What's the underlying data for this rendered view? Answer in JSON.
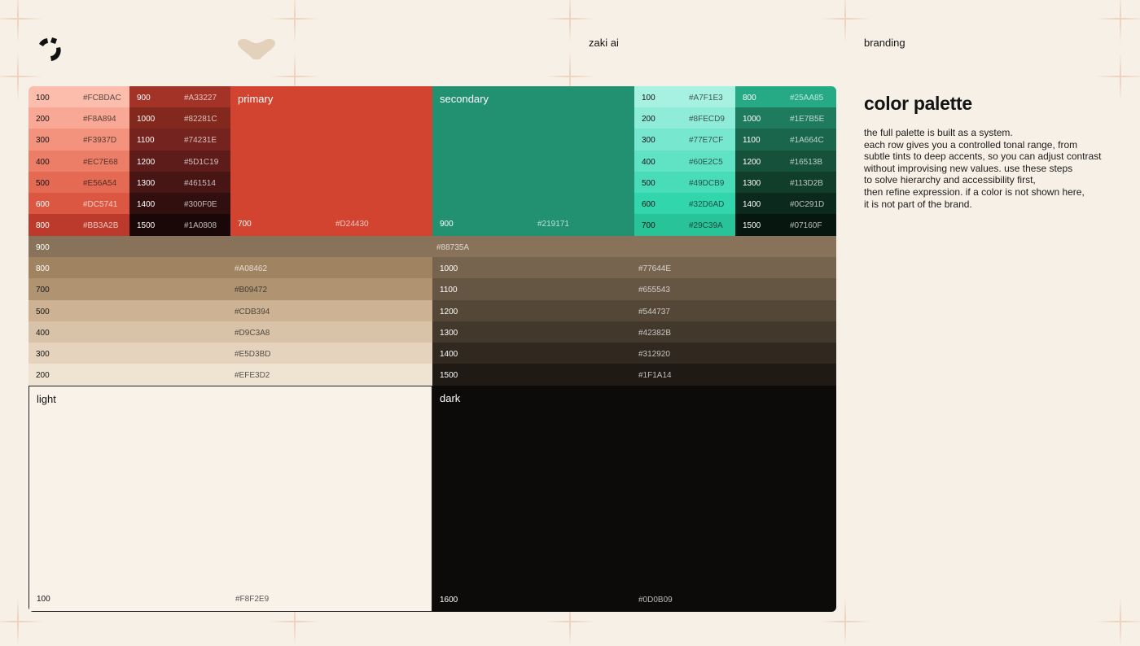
{
  "header": {
    "app_name": "zaki ai",
    "section": "branding"
  },
  "panel": {
    "title": "color palette",
    "description": "the full palette is built as a system.\neach row gives you a controlled tonal range, from\nsubtle tints to deep accents, so you can adjust contrast\nwithout improvising new values. use these steps\nto solve hierarchy and accessibility first,\nthen refine expression. if a color is not shown here,\nit is not part of the brand."
  },
  "colors": {
    "page_bg": "#F6F0E6",
    "accent": "#D24430"
  },
  "icons": [
    "logo-icon",
    "heart-mark-icon"
  ],
  "palette": {
    "primary_tints": [
      {
        "level": "100",
        "hex": "#FCBDAC"
      },
      {
        "level": "200",
        "hex": "#F8A894"
      },
      {
        "level": "300",
        "hex": "#F3937D"
      },
      {
        "level": "400",
        "hex": "#EC7E68"
      },
      {
        "level": "500",
        "hex": "#E56A54"
      },
      {
        "level": "600",
        "hex": "#DC5741"
      },
      {
        "level": "800",
        "hex": "#BB3A2B"
      }
    ],
    "primary_shades": [
      {
        "level": "900",
        "hex": "#A33227"
      },
      {
        "level": "1000",
        "hex": "#82281C"
      },
      {
        "level": "1100",
        "hex": "#74231E"
      },
      {
        "level": "1200",
        "hex": "#5D1C19"
      },
      {
        "level": "1300",
        "hex": "#461514"
      },
      {
        "level": "1400",
        "hex": "#300F0E"
      },
      {
        "level": "1500",
        "hex": "#1A0808"
      }
    ],
    "primary_main": {
      "name": "primary",
      "level": "700",
      "hex": "#D24430"
    },
    "secondary_main": {
      "name": "secondary",
      "level": "900",
      "hex": "#219171"
    },
    "secondary_tints": [
      {
        "level": "100",
        "hex": "#A7F1E3"
      },
      {
        "level": "200",
        "hex": "#8FECD9"
      },
      {
        "level": "300",
        "hex": "#77E7CF"
      },
      {
        "level": "400",
        "hex": "#60E2C5"
      },
      {
        "level": "500",
        "hex": "#49DCB9"
      },
      {
        "level": "600",
        "hex": "#32D6AD"
      },
      {
        "level": "700",
        "hex": "#29C39A"
      }
    ],
    "secondary_shades": [
      {
        "level": "800",
        "hex": "#25AA85"
      },
      {
        "level": "1000",
        "hex": "#1E7B5E"
      },
      {
        "level": "1100",
        "hex": "#1A664C"
      },
      {
        "level": "1200",
        "hex": "#16513B"
      },
      {
        "level": "1300",
        "hex": "#113D2B"
      },
      {
        "level": "1400",
        "hex": "#0C291D"
      },
      {
        "level": "1500",
        "hex": "#07160F"
      }
    ],
    "neutral_900": {
      "level": "900",
      "hex": "#88735A"
    },
    "neutral_light": [
      {
        "level": "800",
        "hex": "#A08462"
      },
      {
        "level": "700",
        "hex": "#B09472"
      },
      {
        "level": "500",
        "hex": "#CDB394"
      },
      {
        "level": "400",
        "hex": "#D9C3A8"
      },
      {
        "level": "300",
        "hex": "#E5D3BD"
      },
      {
        "level": "200",
        "hex": "#EFE3D2"
      }
    ],
    "neutral_dark": [
      {
        "level": "1000",
        "hex": "#77644E"
      },
      {
        "level": "1100",
        "hex": "#655543"
      },
      {
        "level": "1200",
        "hex": "#544737"
      },
      {
        "level": "1300",
        "hex": "#42382B"
      },
      {
        "level": "1400",
        "hex": "#312920"
      },
      {
        "level": "1500",
        "hex": "#1F1A14"
      }
    ],
    "light": {
      "name": "light",
      "level": "100",
      "hex": "#F8F2E9"
    },
    "dark": {
      "name": "dark",
      "level": "1600",
      "hex": "#0D0B09"
    }
  }
}
